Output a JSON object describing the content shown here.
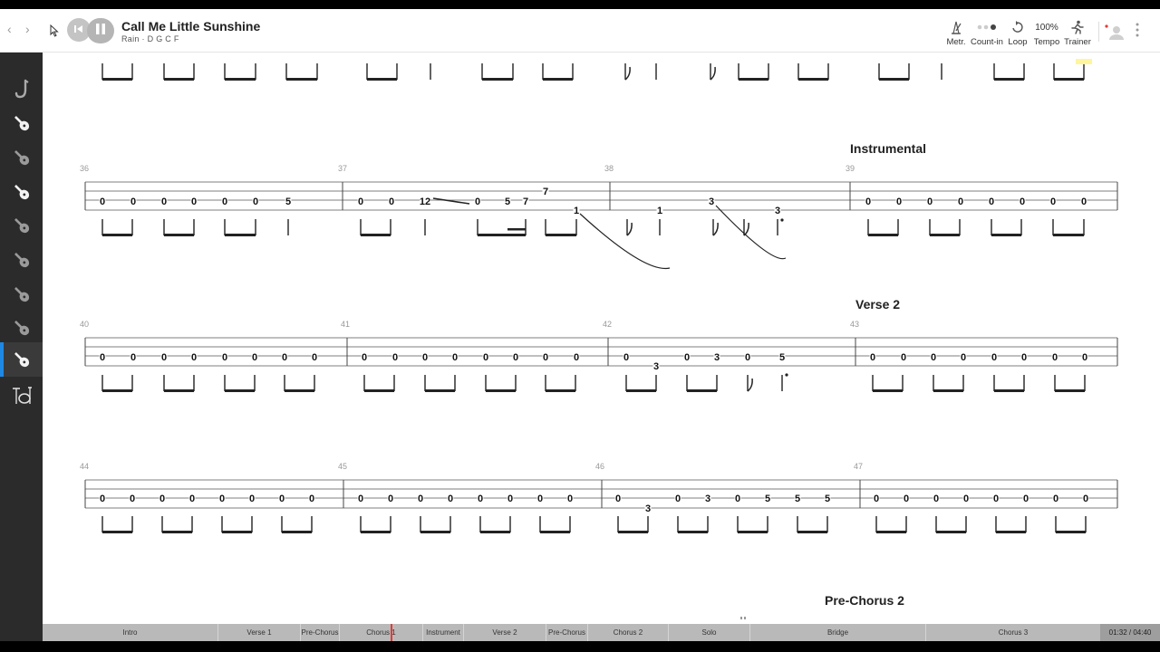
{
  "header": {
    "title": "Call Me Little Sunshine",
    "subtitle": "Rain · D G C F",
    "nav_back": "‹",
    "nav_forward": "›",
    "tools": [
      {
        "id": "metronome",
        "label": "Metr.",
        "icon": "metronome-icon"
      },
      {
        "id": "countin",
        "label": "Count-in",
        "icon": "count-in-icon"
      },
      {
        "id": "loop",
        "label": "Loop",
        "icon": "loop-icon"
      },
      {
        "id": "tempo",
        "label": "Tempo",
        "icon": "tempo-icon",
        "value": "100%"
      },
      {
        "id": "trainer",
        "label": "Trainer",
        "icon": "trainer-icon"
      }
    ]
  },
  "sidebar": {
    "tracks": [
      {
        "icon": "saxophone-icon",
        "active": false
      },
      {
        "icon": "guitar-icon",
        "active": false
      },
      {
        "icon": "guitar-icon",
        "active": false
      },
      {
        "icon": "guitar-icon",
        "active": false
      },
      {
        "icon": "guitar-icon",
        "active": false
      },
      {
        "icon": "guitar-icon",
        "active": false
      },
      {
        "icon": "guitar-icon",
        "active": false
      },
      {
        "icon": "guitar-icon",
        "active": false
      },
      {
        "icon": "bass-guitar-icon",
        "active": true
      },
      {
        "icon": "drums-icon",
        "active": false
      }
    ]
  },
  "score": {
    "sections": {
      "instrumental": "Instrumental",
      "verse2": "Verse 2",
      "prechorus2": "Pre-Chorus 2"
    },
    "measure_numbers": [
      "36",
      "37",
      "38",
      "39",
      "40",
      "41",
      "42",
      "43",
      "44",
      "45",
      "46",
      "47"
    ],
    "measures": {
      "36": [
        "0",
        "0",
        "0",
        "0",
        "0",
        "0",
        "5"
      ],
      "37": [
        "0",
        "0",
        "12",
        "0",
        "5",
        "7",
        "7"
      ],
      "38": [
        "1",
        "1",
        "3",
        "3"
      ],
      "39": [
        "0",
        "0",
        "0",
        "0",
        "0",
        "0",
        "0",
        "0"
      ],
      "40": [
        "0",
        "0",
        "0",
        "0",
        "0",
        "0",
        "0",
        "0"
      ],
      "41": [
        "0",
        "0",
        "0",
        "0",
        "0",
        "0",
        "0",
        "0"
      ],
      "42": [
        "0",
        "3",
        "0",
        "3",
        "0",
        "5"
      ],
      "43": [
        "0",
        "0",
        "0",
        "0",
        "0",
        "0",
        "0",
        "0"
      ],
      "44": [
        "0",
        "0",
        "0",
        "0",
        "0",
        "0",
        "0",
        "0"
      ],
      "45": [
        "0",
        "0",
        "0",
        "0",
        "0",
        "0",
        "0",
        "0"
      ],
      "46": [
        "0",
        "3",
        "0",
        "3",
        "0",
        "5",
        "5",
        "5"
      ],
      "47": [
        "0",
        "0",
        "0",
        "0",
        "0",
        "0",
        "0",
        "0"
      ]
    }
  },
  "timeline": {
    "sections": [
      "Intro",
      "Verse 1",
      "Pre-Chorus",
      "Chorus 1",
      "Instrument",
      "Verse 2",
      "Pre-Chorus",
      "Chorus 2",
      "Solo",
      "Bridge",
      "Chorus 3"
    ],
    "time": "01:32 / 04:40"
  },
  "colors": {
    "sidebar": "#2b2b2b",
    "active_track": "#1e88e5",
    "playhead": "#e53935",
    "timeline": "#b9b9b9",
    "highlight": "#fff59d"
  }
}
